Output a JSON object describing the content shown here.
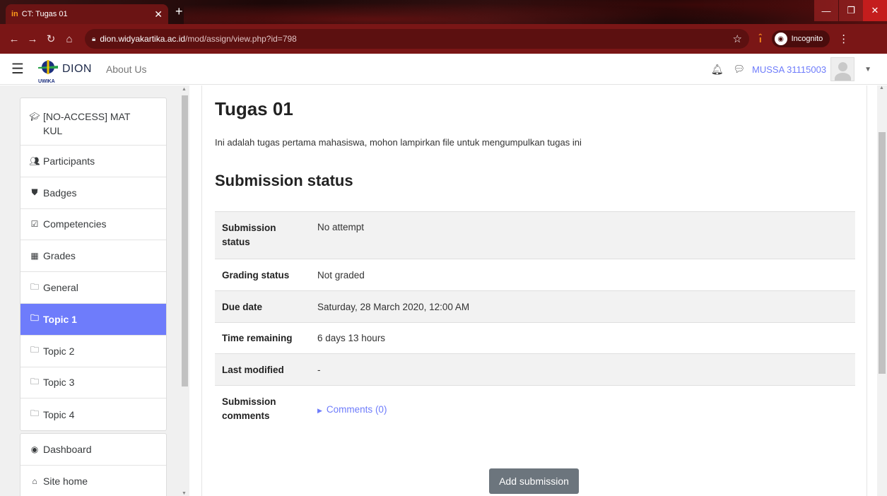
{
  "browser": {
    "tab_favicon": "in",
    "tab_title": "CT: Tugas 01",
    "url_host": "dion.widyakartika.ac.id",
    "url_path": "/mod/assign/view.php?id=798",
    "incognito_label": "Incognito"
  },
  "header": {
    "logo_text": "DION",
    "logo_sub": "UWIKA",
    "about_link": "About Us",
    "user_name": "MUSSA 31115003"
  },
  "sidebar": {
    "items": [
      {
        "label": "[NO-ACCESS] MAT KUL",
        "icon": "graduation-cap-icon"
      },
      {
        "label": "Participants",
        "icon": "users-icon"
      },
      {
        "label": "Badges",
        "icon": "shield-icon"
      },
      {
        "label": "Competencies",
        "icon": "check-square-icon"
      },
      {
        "label": "Grades",
        "icon": "table-icon"
      },
      {
        "label": "General",
        "icon": "folder-icon"
      },
      {
        "label": "Topic 1",
        "icon": "folder-icon"
      },
      {
        "label": "Topic 2",
        "icon": "folder-icon"
      },
      {
        "label": "Topic 3",
        "icon": "folder-icon"
      },
      {
        "label": "Topic 4",
        "icon": "folder-icon"
      },
      {
        "label": "Dashboard",
        "icon": "dashboard-icon"
      },
      {
        "label": "Site home",
        "icon": "home-icon"
      }
    ],
    "active_item": "Topic 1"
  },
  "main": {
    "title": "Tugas 01",
    "intro": "Ini adalah tugas pertama mahasiswa, mohon lampirkan file untuk mengumpulkan tugas ini",
    "section_heading": "Submission status",
    "rows": [
      {
        "label": "Submission status",
        "value": "No attempt"
      },
      {
        "label": "Grading status",
        "value": "Not graded"
      },
      {
        "label": "Due date",
        "value": "Saturday, 28 March 2020, 12:00 AM"
      },
      {
        "label": "Time remaining",
        "value": "6 days 13 hours"
      },
      {
        "label": "Last modified",
        "value": "-"
      },
      {
        "label": "Submission comments",
        "value": "Comments (0)"
      }
    ],
    "add_submission": "Add submission"
  },
  "colors": {
    "accent": "#6e7cfb",
    "browser_frame": "#7a1616",
    "button": "#6c757d"
  }
}
